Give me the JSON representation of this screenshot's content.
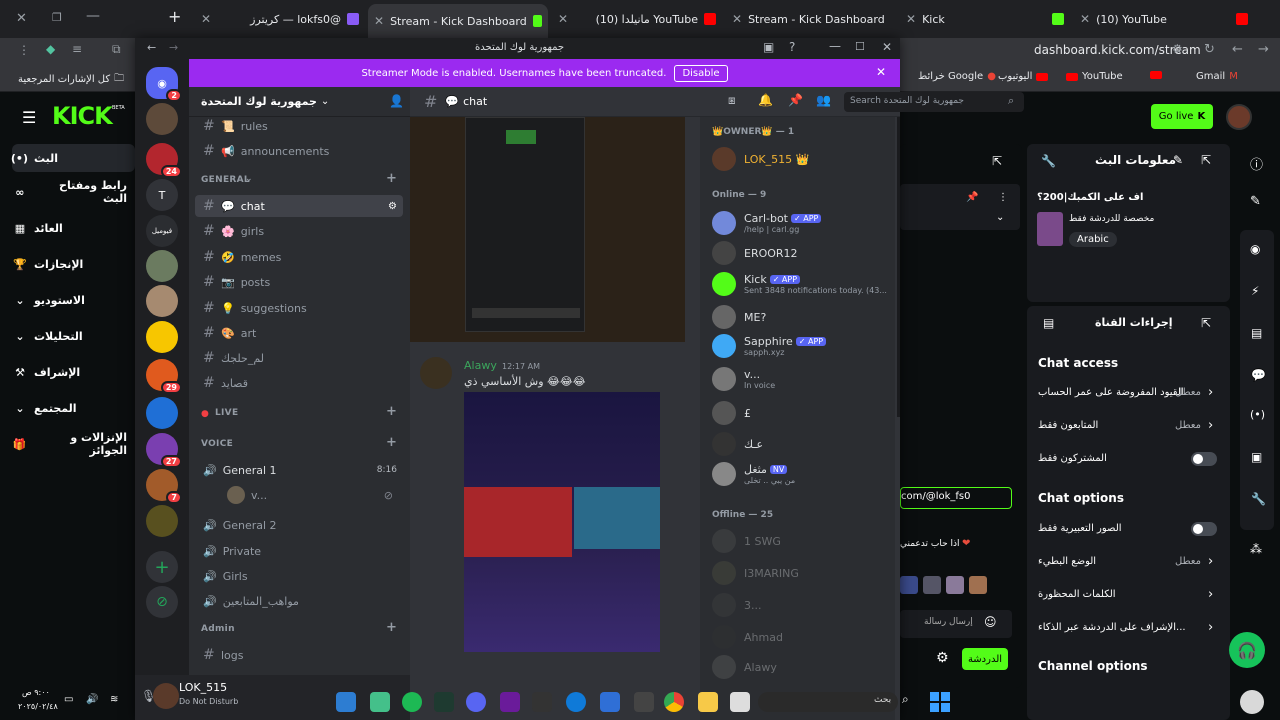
{
  "browser": {
    "tabs": [
      {
        "label": "كريترز — lokfs0@",
        "color": "#8a5cf6"
      },
      {
        "label": "Stream - Kick Dashboard",
        "color": "#53fc18"
      },
      {
        "label": "(10) مانيلدا YouTube",
        "color": "#ff0000"
      },
      {
        "label": "Stream - Kick Dashboard",
        "color": "#53fc18"
      },
      {
        "label": "Kick",
        "color": "#53fc18"
      },
      {
        "label": "(10) YouTube",
        "color": "#ff0000"
      }
    ],
    "url": "dashboard.kick.com/stream",
    "bookmarks": [
      {
        "label": "كل الإشارات المرجعية"
      },
      {
        "label": "خرائط Google"
      },
      {
        "label": "اليوتيوب"
      },
      {
        "label": "YouTube"
      },
      {
        "label": "Gmail"
      }
    ]
  },
  "kick": {
    "logo": "KICK",
    "beta": "BETA",
    "nav": [
      {
        "label": "البث",
        "icon": "(•)"
      },
      {
        "label": "رابط ومفتاح البث",
        "icon": "∞"
      },
      {
        "label": "العائد",
        "icon": "▦"
      },
      {
        "label": "الإنجازات",
        "icon": "🏆"
      },
      {
        "label": "الاستوديو",
        "icon": "⌄"
      },
      {
        "label": "التحليلات",
        "icon": "⌄"
      },
      {
        "label": "الإشراف",
        "icon": "⚒"
      },
      {
        "label": "المجتمع",
        "icon": "⌄"
      },
      {
        "label": "الإنزالات و الجوائز",
        "icon": "🎁"
      }
    ],
    "go_live": "Go live",
    "stream_info": {
      "title": "معلومات البث",
      "stream_title": "اف على الكمبك|200؟",
      "category": "مخصصة للدردشة فقط",
      "language": "Arabic"
    },
    "channel_actions": {
      "title": "إجراءات القناة",
      "chat_access": "Chat access",
      "rows_access": [
        {
          "label": "القيود المفروضة على عمر الحساب",
          "state": "معطل"
        },
        {
          "label": "المتابعون فقط",
          "state": "معطل"
        },
        {
          "label": "المشتركون فقط",
          "state": ""
        }
      ],
      "chat_options": "Chat options",
      "rows_options": [
        {
          "label": "الصور التعبيرية فقط",
          "state": ""
        },
        {
          "label": "الوضع البطيء",
          "state": "معطل"
        },
        {
          "label": "الكلمات المحظورة",
          "state": ""
        },
        {
          "label": "الإشراف على الدردشة عبر الذكاء...",
          "state": ""
        }
      ],
      "channel_options": "Channel options"
    },
    "chat_panel": {
      "link": "com/@lok_fs0",
      "msg": "اذا حاب تدعمني",
      "input_placeholder": "إرسال رسالة",
      "send": "الدردشة"
    }
  },
  "discord": {
    "window_title": "جمهورية لوك المتحدة",
    "banner_text": "Streamer Mode is enabled. Usernames have been truncated.",
    "banner_button": "Disable",
    "server_name": "جمهورية لوك المتحدة",
    "servers": [
      {
        "label": "",
        "badge": "2",
        "color": "#5865f2"
      },
      {
        "label": "",
        "badge": "",
        "color": "#5d4a3a"
      },
      {
        "label": "",
        "badge": "24",
        "color": "#b3262e"
      },
      {
        "label": "T",
        "badge": "",
        "color": "#313338"
      },
      {
        "label": "فيوميل",
        "badge": "",
        "color": "#2b2d31"
      },
      {
        "label": "",
        "badge": "",
        "color": "#6b7b60"
      },
      {
        "label": "",
        "badge": "",
        "color": "#a68a70"
      },
      {
        "label": "",
        "badge": "",
        "color": "#f7c600"
      },
      {
        "label": "",
        "badge": "29",
        "color": "#e05a1e"
      },
      {
        "label": "",
        "badge": "",
        "color": "#1f6fd6"
      },
      {
        "label": "",
        "badge": "27",
        "color": "#7a3fb0"
      },
      {
        "label": "",
        "badge": "7",
        "color": "#a25b2a"
      },
      {
        "label": "",
        "badge": "",
        "color": "#58501f"
      }
    ],
    "channels_top": [
      {
        "name": "rules",
        "emoji": "📜"
      },
      {
        "name": "announcements",
        "emoji": "📢"
      }
    ],
    "cat_general": "GENERAL",
    "channels_general": [
      {
        "name": "chat",
        "emoji": "💬"
      },
      {
        "name": "girls",
        "emoji": "🌸"
      },
      {
        "name": "memes",
        "emoji": "🤣"
      },
      {
        "name": "posts",
        "emoji": "📷"
      },
      {
        "name": "suggestions",
        "emoji": "💡"
      },
      {
        "name": "art",
        "emoji": "🎨"
      },
      {
        "name": "لم_حلجك",
        "emoji": ""
      },
      {
        "name": "قصايد",
        "emoji": ""
      }
    ],
    "cat_live": "LIVE",
    "cat_voice": "VOICE",
    "voice": [
      {
        "name": "General 1",
        "extra": "8:16"
      },
      {
        "name": "General 2",
        "extra": ""
      },
      {
        "name": "Private",
        "extra": ""
      },
      {
        "name": "Girls",
        "extra": ""
      },
      {
        "name": "مواهب_المتابعين",
        "extra": ""
      }
    ],
    "voice_user": "v...",
    "cat_admin": "Admin",
    "admin_channels": [
      {
        "name": "logs"
      }
    ],
    "user": {
      "name": "LOK_515",
      "status": "Do Not Disturb"
    },
    "chat_channel": "chat",
    "search_placeholder": "Search جمهورية لوك المتحدة",
    "message": {
      "author": "Alawy",
      "time": "12:17 AM",
      "text": "وش الأساسي ذي 😂😂😂"
    },
    "members": {
      "owner_header": "👑OWNER👑 — 1",
      "owner": {
        "name": "LOK_515 👑"
      },
      "online_header": "Online — 9",
      "online": [
        {
          "name": "Carl-bot",
          "app": "✓ APP",
          "sub": "/help | carl.gg",
          "color": "#7289da"
        },
        {
          "name": "EROOR12",
          "app": "",
          "sub": "",
          "color": "#444"
        },
        {
          "name": "Kick",
          "app": "✓ APP",
          "sub": "Sent 3848 notifications today. (43...",
          "color": "#53fc18"
        },
        {
          "name": "ME?",
          "app": "",
          "sub": "",
          "color": "#666"
        },
        {
          "name": "Sapphire",
          "app": "✓ APP",
          "sub": "sapph.xyz",
          "color": "#3fa9f5"
        },
        {
          "name": "v...",
          "app": "",
          "sub": "In voice",
          "color": "#777"
        },
        {
          "name": "£",
          "app": "",
          "sub": "",
          "color": "#555"
        },
        {
          "name": "عـك",
          "app": "",
          "sub": "",
          "color": "#333"
        },
        {
          "name": "مثغل",
          "app": "NV",
          "sub": "من يبي .. تخلى",
          "color": "#888"
        }
      ],
      "offline_header": "Offline — 25",
      "offline": [
        {
          "name": "1 SWG",
          "sub": "",
          "color": "#555"
        },
        {
          "name": "I3MARING",
          "sub": "",
          "color": "#554"
        },
        {
          "name": "3...",
          "sub": "",
          "color": "#444"
        },
        {
          "name": "Ahmad",
          "sub": "",
          "color": "#333"
        },
        {
          "name": "Alawy",
          "sub": "",
          "color": "#666"
        }
      ]
    }
  },
  "taskbar": {
    "time": "٩:٠٠ ص",
    "date": "٢٠٢٥/٠٢/٤٨",
    "search": "بحث"
  }
}
